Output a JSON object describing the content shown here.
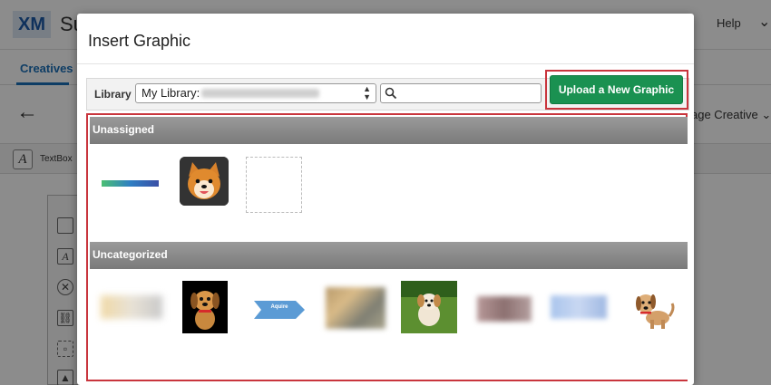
{
  "background": {
    "logo": "XM",
    "title_fragment": "Su",
    "help_label": "Help",
    "tab_creatives": "Creatives",
    "manage_label": "age Creative",
    "toolbar_textbox_label": "TextBox"
  },
  "modal": {
    "title": "Insert Graphic",
    "library_label": "Library",
    "library_select_value": "My Library:",
    "search_placeholder": "",
    "upload_button_label": "Upload a New Graphic"
  },
  "sections": {
    "unassigned": {
      "label": "Unassigned"
    },
    "uncategorized": {
      "label": "Uncategorized",
      "arrow_thumb_text": "Aquire"
    }
  },
  "colors": {
    "accent_green": "#1a9151",
    "highlight_red": "#c9353d",
    "header_gray": "#8a8a8a",
    "link_blue": "#1a6fb8"
  }
}
